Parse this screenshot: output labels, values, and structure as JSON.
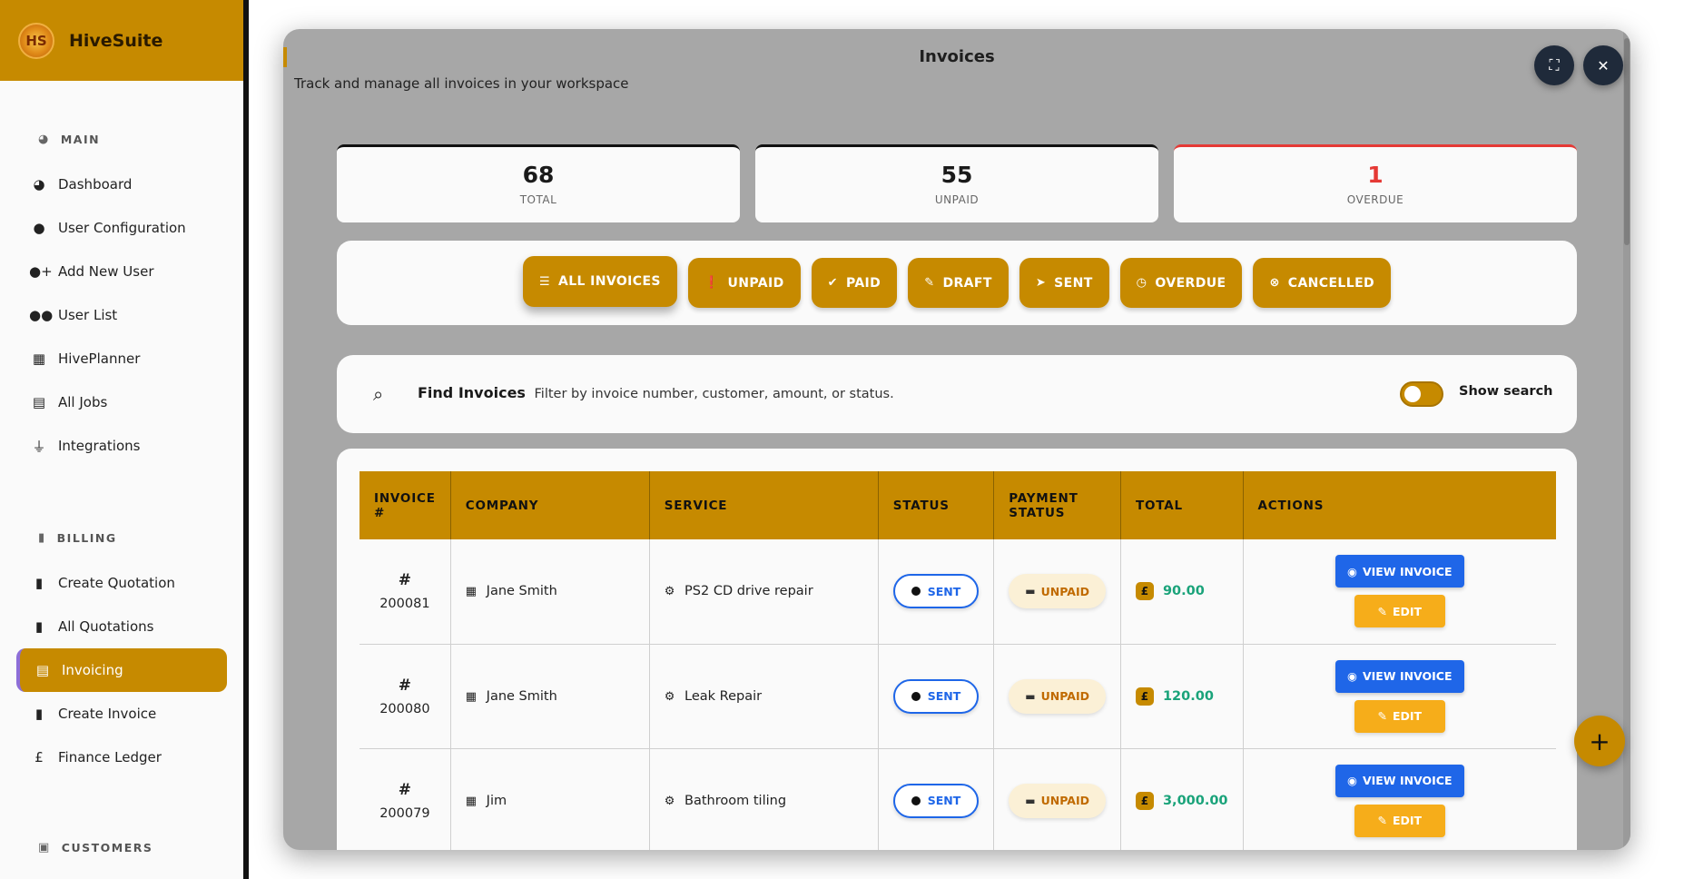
{
  "brand": {
    "name": "HiveSuite",
    "logo_text": "HS"
  },
  "sidebar": {
    "sections": [
      {
        "title": "MAIN",
        "icon": "gauge-icon",
        "items": [
          {
            "label": "Dashboard",
            "icon": "gauge-icon"
          },
          {
            "label": "User Configuration",
            "icon": "user-icon"
          },
          {
            "label": "Add New User",
            "icon": "user-plus-icon"
          },
          {
            "label": "User List",
            "icon": "users-icon"
          },
          {
            "label": "HivePlanner",
            "icon": "calendar-icon"
          },
          {
            "label": "All Jobs",
            "icon": "briefcase-icon"
          },
          {
            "label": "Integrations",
            "icon": "plug-icon"
          }
        ]
      },
      {
        "title": "BILLING",
        "icon": "file-icon",
        "items": [
          {
            "label": "Create Quotation",
            "icon": "file-invoice-icon"
          },
          {
            "label": "All Quotations",
            "icon": "file-icon"
          },
          {
            "label": "Invoicing",
            "icon": "file-lines-icon",
            "active": true
          },
          {
            "label": "Create Invoice",
            "icon": "file-invoice-icon"
          },
          {
            "label": "Finance Ledger",
            "icon": "pound-icon"
          }
        ]
      },
      {
        "title": "CUSTOMERS",
        "icon": "address-book-icon",
        "items": []
      }
    ]
  },
  "modal": {
    "title": "Invoices",
    "subtitle": "Track and manage all invoices in your workspace",
    "expand_icon": "expand-icon",
    "close_icon": "close-icon"
  },
  "stats": [
    {
      "value": "68",
      "label": "TOTAL"
    },
    {
      "value": "55",
      "label": "UNPAID"
    },
    {
      "value": "1",
      "label": "OVERDUE",
      "color": "#e53935"
    }
  ],
  "filters": [
    {
      "label": "ALL INVOICES",
      "icon": "list-icon",
      "active": true
    },
    {
      "label": "UNPAID",
      "icon": "exclamation-circle-icon"
    },
    {
      "label": "PAID",
      "icon": "check-circle-icon"
    },
    {
      "label": "DRAFT",
      "icon": "edit-icon"
    },
    {
      "label": "SENT",
      "icon": "paper-plane-icon"
    },
    {
      "label": "OVERDUE",
      "icon": "clock-icon"
    },
    {
      "label": "CANCELLED",
      "icon": "x-circle-icon"
    }
  ],
  "search": {
    "title": "Find Invoices",
    "hint": "Filter by invoice number, customer, amount, or status.",
    "toggle_label": "Show search",
    "toggle_on": false
  },
  "table": {
    "headers": [
      "INVOICE #",
      "COMPANY",
      "SERVICE",
      "STATUS",
      "PAYMENT STATUS",
      "TOTAL",
      "ACTIONS"
    ],
    "rows": [
      {
        "hash": "#",
        "number": "200081",
        "company": "Jane Smith",
        "service": "PS2 CD drive repair",
        "status": "SENT",
        "payment": "UNPAID",
        "total": "90.00"
      },
      {
        "hash": "#",
        "number": "200080",
        "company": "Jane Smith",
        "service": "Leak Repair",
        "status": "SENT",
        "payment": "UNPAID",
        "total": "120.00"
      },
      {
        "hash": "#",
        "number": "200079",
        "company": "Jim",
        "service": "Bathroom tiling",
        "status": "SENT",
        "payment": "UNPAID",
        "total": "3,000.00"
      }
    ],
    "view_label": "VIEW INVOICE",
    "edit_label": "EDIT",
    "currency_symbol": "£"
  },
  "fab": {
    "label": "+",
    "icon": "plus-icon"
  },
  "colors": {
    "accent": "#c68a00",
    "primary_blue": "#1f66e8",
    "edit_orange": "#f6ad1a",
    "overdue_red": "#e53935",
    "total_green": "#1aa37a"
  }
}
